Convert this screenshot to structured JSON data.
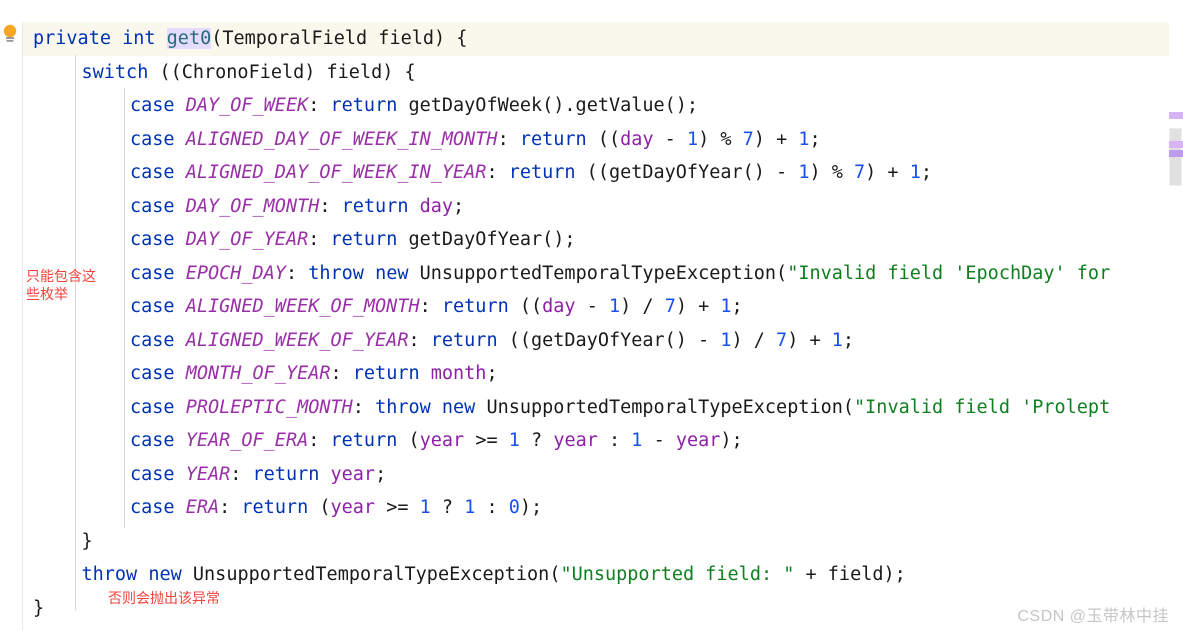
{
  "editor": {
    "language": "java",
    "theme": "light",
    "highlighted_line_index": 0,
    "colors": {
      "background": "#ffffff",
      "current_line_highlight": "#faf8ec",
      "keyword": "#0033b3",
      "enum_constant": "#9a30a8",
      "field": "#8f1ea8",
      "number": "#1750eb",
      "string": "#0f8020",
      "method_declaration": "#2b6a7d",
      "method_highlight_bg": "#e3dcfb",
      "annotation_red": "#f0433c",
      "indent_guide": "#d8d8d8",
      "scrollbar_marker": "#d6b3f5"
    }
  },
  "gutter": {
    "bulb_icon": "lightbulb-icon",
    "bulb_tooltip": "Show Context Actions"
  },
  "code_lines": [
    {
      "indent": 0,
      "highlighted": true,
      "tokens": [
        {
          "t": "private",
          "c": "kw"
        },
        {
          "t": " ",
          "c": "plain"
        },
        {
          "t": "int",
          "c": "kw"
        },
        {
          "t": " ",
          "c": "plain"
        },
        {
          "t": "get0",
          "c": "method methodhl"
        },
        {
          "t": "(TemporalField field) {",
          "c": "plain"
        }
      ]
    },
    {
      "indent": 1,
      "highlighted": false,
      "tokens": [
        {
          "t": "switch",
          "c": "kw"
        },
        {
          "t": " ((ChronoField) field) {",
          "c": "plain"
        }
      ]
    },
    {
      "indent": 2,
      "highlighted": false,
      "tokens": [
        {
          "t": "case",
          "c": "kw"
        },
        {
          "t": " ",
          "c": "plain"
        },
        {
          "t": "DAY_OF_WEEK",
          "c": "enumc"
        },
        {
          "t": ": ",
          "c": "plain"
        },
        {
          "t": "return",
          "c": "kw"
        },
        {
          "t": " getDayOfWeek().getValue();",
          "c": "plain"
        }
      ]
    },
    {
      "indent": 2,
      "highlighted": false,
      "tokens": [
        {
          "t": "case",
          "c": "kw"
        },
        {
          "t": " ",
          "c": "plain"
        },
        {
          "t": "ALIGNED_DAY_OF_WEEK_IN_MONTH",
          "c": "enumc"
        },
        {
          "t": ": ",
          "c": "plain"
        },
        {
          "t": "return",
          "c": "kw"
        },
        {
          "t": " ((",
          "c": "plain"
        },
        {
          "t": "day",
          "c": "field"
        },
        {
          "t": " - ",
          "c": "plain"
        },
        {
          "t": "1",
          "c": "num"
        },
        {
          "t": ") % ",
          "c": "plain"
        },
        {
          "t": "7",
          "c": "num"
        },
        {
          "t": ") + ",
          "c": "plain"
        },
        {
          "t": "1",
          "c": "num"
        },
        {
          "t": ";",
          "c": "plain"
        }
      ]
    },
    {
      "indent": 2,
      "highlighted": false,
      "tokens": [
        {
          "t": "case",
          "c": "kw"
        },
        {
          "t": " ",
          "c": "plain"
        },
        {
          "t": "ALIGNED_DAY_OF_WEEK_IN_YEAR",
          "c": "enumc"
        },
        {
          "t": ": ",
          "c": "plain"
        },
        {
          "t": "return",
          "c": "kw"
        },
        {
          "t": " ((getDayOfYear() - ",
          "c": "plain"
        },
        {
          "t": "1",
          "c": "num"
        },
        {
          "t": ") % ",
          "c": "plain"
        },
        {
          "t": "7",
          "c": "num"
        },
        {
          "t": ") + ",
          "c": "plain"
        },
        {
          "t": "1",
          "c": "num"
        },
        {
          "t": ";",
          "c": "plain"
        }
      ]
    },
    {
      "indent": 2,
      "highlighted": false,
      "tokens": [
        {
          "t": "case",
          "c": "kw"
        },
        {
          "t": " ",
          "c": "plain"
        },
        {
          "t": "DAY_OF_MONTH",
          "c": "enumc"
        },
        {
          "t": ": ",
          "c": "plain"
        },
        {
          "t": "return",
          "c": "kw"
        },
        {
          "t": " ",
          "c": "plain"
        },
        {
          "t": "day",
          "c": "field"
        },
        {
          "t": ";",
          "c": "plain"
        }
      ]
    },
    {
      "indent": 2,
      "highlighted": false,
      "tokens": [
        {
          "t": "case",
          "c": "kw"
        },
        {
          "t": " ",
          "c": "plain"
        },
        {
          "t": "DAY_OF_YEAR",
          "c": "enumc"
        },
        {
          "t": ": ",
          "c": "plain"
        },
        {
          "t": "return",
          "c": "kw"
        },
        {
          "t": " getDayOfYear();",
          "c": "plain"
        }
      ]
    },
    {
      "indent": 2,
      "highlighted": false,
      "tokens": [
        {
          "t": "case",
          "c": "kw"
        },
        {
          "t": " ",
          "c": "plain"
        },
        {
          "t": "EPOCH_DAY",
          "c": "enumc"
        },
        {
          "t": ": ",
          "c": "plain"
        },
        {
          "t": "throw",
          "c": "kw"
        },
        {
          "t": " ",
          "c": "plain"
        },
        {
          "t": "new",
          "c": "kw"
        },
        {
          "t": " UnsupportedTemporalTypeException(",
          "c": "plain"
        },
        {
          "t": "\"Invalid field 'EpochDay' for",
          "c": "str"
        }
      ]
    },
    {
      "indent": 2,
      "highlighted": false,
      "tokens": [
        {
          "t": "case",
          "c": "kw"
        },
        {
          "t": " ",
          "c": "plain"
        },
        {
          "t": "ALIGNED_WEEK_OF_MONTH",
          "c": "enumc"
        },
        {
          "t": ": ",
          "c": "plain"
        },
        {
          "t": "return",
          "c": "kw"
        },
        {
          "t": " ((",
          "c": "plain"
        },
        {
          "t": "day",
          "c": "field"
        },
        {
          "t": " - ",
          "c": "plain"
        },
        {
          "t": "1",
          "c": "num"
        },
        {
          "t": ") / ",
          "c": "plain"
        },
        {
          "t": "7",
          "c": "num"
        },
        {
          "t": ") + ",
          "c": "plain"
        },
        {
          "t": "1",
          "c": "num"
        },
        {
          "t": ";",
          "c": "plain"
        }
      ]
    },
    {
      "indent": 2,
      "highlighted": false,
      "tokens": [
        {
          "t": "case",
          "c": "kw"
        },
        {
          "t": " ",
          "c": "plain"
        },
        {
          "t": "ALIGNED_WEEK_OF_YEAR",
          "c": "enumc"
        },
        {
          "t": ": ",
          "c": "plain"
        },
        {
          "t": "return",
          "c": "kw"
        },
        {
          "t": " ((getDayOfYear() - ",
          "c": "plain"
        },
        {
          "t": "1",
          "c": "num"
        },
        {
          "t": ") / ",
          "c": "plain"
        },
        {
          "t": "7",
          "c": "num"
        },
        {
          "t": ") + ",
          "c": "plain"
        },
        {
          "t": "1",
          "c": "num"
        },
        {
          "t": ";",
          "c": "plain"
        }
      ]
    },
    {
      "indent": 2,
      "highlighted": false,
      "tokens": [
        {
          "t": "case",
          "c": "kw"
        },
        {
          "t": " ",
          "c": "plain"
        },
        {
          "t": "MONTH_OF_YEAR",
          "c": "enumc"
        },
        {
          "t": ": ",
          "c": "plain"
        },
        {
          "t": "return",
          "c": "kw"
        },
        {
          "t": " ",
          "c": "plain"
        },
        {
          "t": "month",
          "c": "field"
        },
        {
          "t": ";",
          "c": "plain"
        }
      ]
    },
    {
      "indent": 2,
      "highlighted": false,
      "tokens": [
        {
          "t": "case",
          "c": "kw"
        },
        {
          "t": " ",
          "c": "plain"
        },
        {
          "t": "PROLEPTIC_MONTH",
          "c": "enumc"
        },
        {
          "t": ": ",
          "c": "plain"
        },
        {
          "t": "throw",
          "c": "kw"
        },
        {
          "t": " ",
          "c": "plain"
        },
        {
          "t": "new",
          "c": "kw"
        },
        {
          "t": " UnsupportedTemporalTypeException(",
          "c": "plain"
        },
        {
          "t": "\"Invalid field 'Prolept",
          "c": "str"
        }
      ]
    },
    {
      "indent": 2,
      "highlighted": false,
      "tokens": [
        {
          "t": "case",
          "c": "kw"
        },
        {
          "t": " ",
          "c": "plain"
        },
        {
          "t": "YEAR_OF_ERA",
          "c": "enumc"
        },
        {
          "t": ": ",
          "c": "plain"
        },
        {
          "t": "return",
          "c": "kw"
        },
        {
          "t": " (",
          "c": "plain"
        },
        {
          "t": "year",
          "c": "field"
        },
        {
          "t": " >= ",
          "c": "plain"
        },
        {
          "t": "1",
          "c": "num"
        },
        {
          "t": " ? ",
          "c": "plain"
        },
        {
          "t": "year",
          "c": "field"
        },
        {
          "t": " : ",
          "c": "plain"
        },
        {
          "t": "1",
          "c": "num"
        },
        {
          "t": " - ",
          "c": "plain"
        },
        {
          "t": "year",
          "c": "field"
        },
        {
          "t": ");",
          "c": "plain"
        }
      ]
    },
    {
      "indent": 2,
      "highlighted": false,
      "tokens": [
        {
          "t": "case",
          "c": "kw"
        },
        {
          "t": " ",
          "c": "plain"
        },
        {
          "t": "YEAR",
          "c": "enumc"
        },
        {
          "t": ": ",
          "c": "plain"
        },
        {
          "t": "return",
          "c": "kw"
        },
        {
          "t": " ",
          "c": "plain"
        },
        {
          "t": "year",
          "c": "field"
        },
        {
          "t": ";",
          "c": "plain"
        }
      ]
    },
    {
      "indent": 2,
      "highlighted": false,
      "tokens": [
        {
          "t": "case",
          "c": "kw"
        },
        {
          "t": " ",
          "c": "plain"
        },
        {
          "t": "ERA",
          "c": "enumc"
        },
        {
          "t": ": ",
          "c": "plain"
        },
        {
          "t": "return",
          "c": "kw"
        },
        {
          "t": " (",
          "c": "plain"
        },
        {
          "t": "year",
          "c": "field"
        },
        {
          "t": " >= ",
          "c": "plain"
        },
        {
          "t": "1",
          "c": "num"
        },
        {
          "t": " ? ",
          "c": "plain"
        },
        {
          "t": "1",
          "c": "num"
        },
        {
          "t": " : ",
          "c": "plain"
        },
        {
          "t": "0",
          "c": "num"
        },
        {
          "t": ");",
          "c": "plain"
        }
      ]
    },
    {
      "indent": 1,
      "highlighted": false,
      "tokens": [
        {
          "t": "}",
          "c": "plain"
        }
      ]
    },
    {
      "indent": 1,
      "highlighted": false,
      "tokens": [
        {
          "t": "throw",
          "c": "kw"
        },
        {
          "t": " ",
          "c": "plain"
        },
        {
          "t": "new",
          "c": "kw"
        },
        {
          "t": " UnsupportedTemporalTypeException(",
          "c": "plain"
        },
        {
          "t": "\"Unsupported field: \"",
          "c": "str"
        },
        {
          "t": " + field);",
          "c": "plain"
        }
      ]
    },
    {
      "indent": 0,
      "highlighted": false,
      "tokens": [
        {
          "t": "}",
          "c": "plain"
        }
      ]
    }
  ],
  "annotations": {
    "enum_note": "只能包含这\n些枚举",
    "exception_note": "否则会抛出该异常"
  },
  "scrollbar": {
    "markers": [
      "usage-marker",
      "usage-marker",
      "usage-marker"
    ]
  },
  "watermark": {
    "text": "CSDN @玉带林中挂"
  }
}
